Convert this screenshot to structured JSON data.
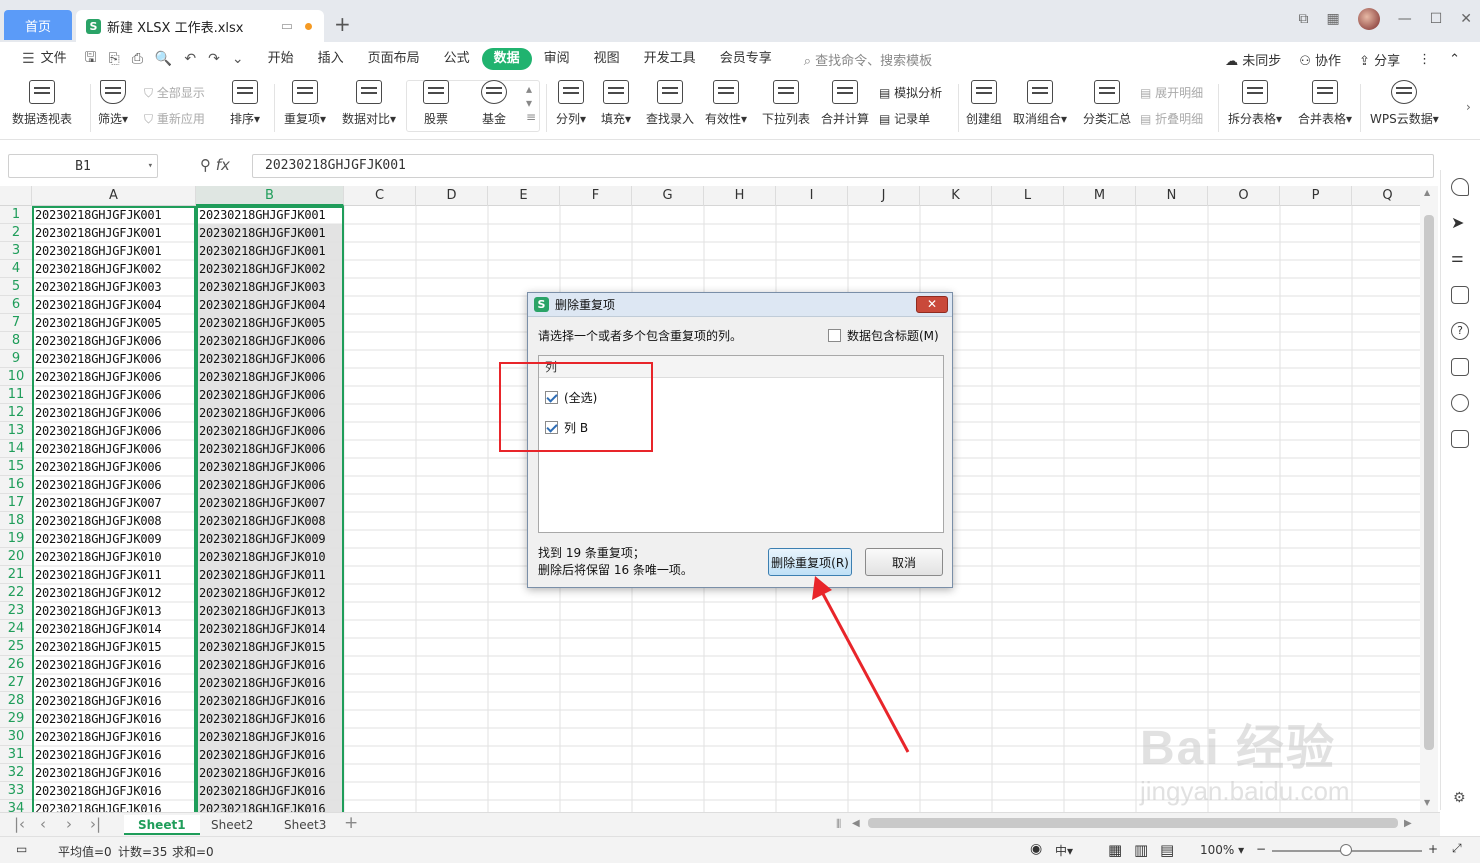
{
  "titlebar": {
    "home_tab": "首页",
    "file_tab": "新建 XLSX 工作表.xlsx",
    "new_tab_icon": "plus-icon"
  },
  "menu": {
    "file": "文件",
    "items": [
      "开始",
      "插入",
      "页面布局",
      "公式",
      "数据",
      "审阅",
      "视图",
      "开发工具",
      "会员专享"
    ],
    "active": "数据",
    "search": "查找命令、搜索模板",
    "sync": "未同步",
    "collab": "协作",
    "share": "分享"
  },
  "ribbon": {
    "pivot": "数据透视表",
    "filter": "筛选",
    "show_all": "全部显示",
    "reapply": "重新应用",
    "sort": "排序",
    "duplicates": "重复项",
    "compare": "数据对比",
    "stock": "股票",
    "fund": "基金",
    "split": "分列",
    "fill": "填充",
    "lookup_entry": "查找录入",
    "validity": "有效性",
    "dropdown": "下拉列表",
    "consolidate": "合并计算",
    "simulate": "模拟分析",
    "record": "记录单",
    "group": "创建组",
    "ungroup": "取消组合",
    "subtotal": "分类汇总",
    "expand": "展开明细",
    "collapse": "折叠明细",
    "split_table": "拆分表格",
    "merge_table": "合并表格",
    "wps_cloud": "WPS云数据"
  },
  "formula_bar": {
    "name_box": "B1",
    "fx": "fx",
    "formula": "20230218GHJGFJK001"
  },
  "columns": [
    "A",
    "B",
    "C",
    "D",
    "E",
    "F",
    "G",
    "H",
    "I",
    "J",
    "K",
    "L",
    "M",
    "N",
    "O",
    "P",
    "Q"
  ],
  "rows": [
    {
      "n": "1",
      "a": "20230218GHJGFJK001",
      "b": "20230218GHJGFJK001"
    },
    {
      "n": "2",
      "a": "20230218GHJGFJK001",
      "b": "20230218GHJGFJK001"
    },
    {
      "n": "3",
      "a": "20230218GHJGFJK001",
      "b": "20230218GHJGFJK001"
    },
    {
      "n": "4",
      "a": "20230218GHJGFJK002",
      "b": "20230218GHJGFJK002"
    },
    {
      "n": "5",
      "a": "20230218GHJGFJK003",
      "b": "20230218GHJGFJK003"
    },
    {
      "n": "6",
      "a": "20230218GHJGFJK004",
      "b": "20230218GHJGFJK004"
    },
    {
      "n": "7",
      "a": "20230218GHJGFJK005",
      "b": "20230218GHJGFJK005"
    },
    {
      "n": "8",
      "a": "20230218GHJGFJK006",
      "b": "20230218GHJGFJK006"
    },
    {
      "n": "9",
      "a": "20230218GHJGFJK006",
      "b": "20230218GHJGFJK006"
    },
    {
      "n": "10",
      "a": "20230218GHJGFJK006",
      "b": "20230218GHJGFJK006"
    },
    {
      "n": "11",
      "a": "20230218GHJGFJK006",
      "b": "20230218GHJGFJK006"
    },
    {
      "n": "12",
      "a": "20230218GHJGFJK006",
      "b": "20230218GHJGFJK006"
    },
    {
      "n": "13",
      "a": "20230218GHJGFJK006",
      "b": "20230218GHJGFJK006"
    },
    {
      "n": "14",
      "a": "20230218GHJGFJK006",
      "b": "20230218GHJGFJK006"
    },
    {
      "n": "15",
      "a": "20230218GHJGFJK006",
      "b": "20230218GHJGFJK006"
    },
    {
      "n": "16",
      "a": "20230218GHJGFJK006",
      "b": "20230218GHJGFJK006"
    },
    {
      "n": "17",
      "a": "20230218GHJGFJK007",
      "b": "20230218GHJGFJK007"
    },
    {
      "n": "18",
      "a": "20230218GHJGFJK008",
      "b": "20230218GHJGFJK008"
    },
    {
      "n": "19",
      "a": "20230218GHJGFJK009",
      "b": "20230218GHJGFJK009"
    },
    {
      "n": "20",
      "a": "20230218GHJGFJK010",
      "b": "20230218GHJGFJK010"
    },
    {
      "n": "21",
      "a": "20230218GHJGFJK011",
      "b": "20230218GHJGFJK011"
    },
    {
      "n": "22",
      "a": "20230218GHJGFJK012",
      "b": "20230218GHJGFJK012"
    },
    {
      "n": "23",
      "a": "20230218GHJGFJK013",
      "b": "20230218GHJGFJK013"
    },
    {
      "n": "24",
      "a": "20230218GHJGFJK014",
      "b": "20230218GHJGFJK014"
    },
    {
      "n": "25",
      "a": "20230218GHJGFJK015",
      "b": "20230218GHJGFJK015"
    },
    {
      "n": "26",
      "a": "20230218GHJGFJK016",
      "b": "20230218GHJGFJK016"
    },
    {
      "n": "27",
      "a": "20230218GHJGFJK016",
      "b": "20230218GHJGFJK016"
    },
    {
      "n": "28",
      "a": "20230218GHJGFJK016",
      "b": "20230218GHJGFJK016"
    },
    {
      "n": "29",
      "a": "20230218GHJGFJK016",
      "b": "20230218GHJGFJK016"
    },
    {
      "n": "30",
      "a": "20230218GHJGFJK016",
      "b": "20230218GHJGFJK016"
    },
    {
      "n": "31",
      "a": "20230218GHJGFJK016",
      "b": "20230218GHJGFJK016"
    },
    {
      "n": "32",
      "a": "20230218GHJGFJK016",
      "b": "20230218GHJGFJK016"
    },
    {
      "n": "33",
      "a": "20230218GHJGFJK016",
      "b": "20230218GHJGFJK016"
    },
    {
      "n": "34",
      "a": "20230218GHJGFJK016",
      "b": "20230218GHJGFJK016"
    }
  ],
  "sheets": [
    "Sheet1",
    "Sheet2",
    "Sheet3"
  ],
  "active_sheet": "Sheet1",
  "status": {
    "average": "平均值=0",
    "count": "计数=35",
    "sum": "求和=0",
    "zoom": "100%"
  },
  "dialog": {
    "title": "删除重复项",
    "prompt": "请选择一个或者多个包含重复项的列。",
    "header_checkbox": "数据包含标题(M)",
    "header_checked": false,
    "list_header": "列",
    "items": [
      {
        "label": "(全选)",
        "checked": true
      },
      {
        "label": "列 B",
        "checked": true
      }
    ],
    "found_line1": "找到 19 条重复项；",
    "found_line2": "删除后将保留 16 条唯一项。",
    "delete_button": "删除重复项(R)",
    "cancel_button": "取消",
    "close_icon": "close-icon"
  },
  "watermark": {
    "brand": "Bai  经验",
    "url": "jingyan.baidu.com"
  },
  "colors": {
    "accent": "#1f9d5a",
    "home_tab": "#5b9bf8",
    "annotation": "#e8252a"
  }
}
